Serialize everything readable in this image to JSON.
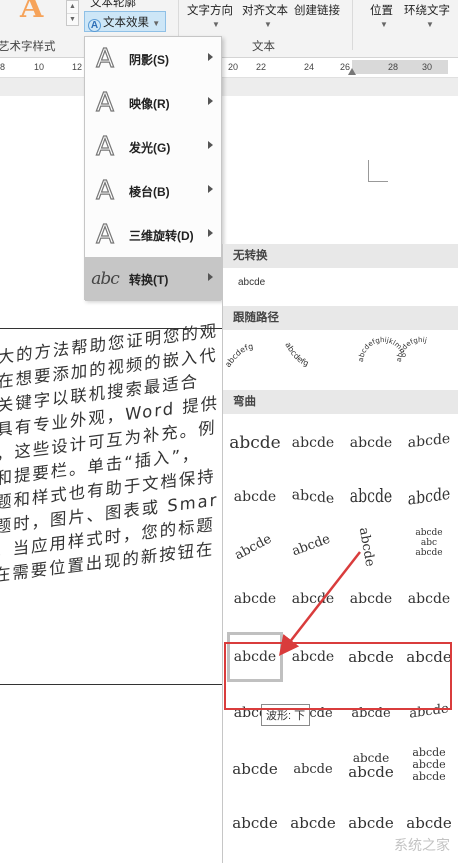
{
  "ribbon": {
    "text_outline_label": "文本轮廓",
    "text_effect_label": "文本效果",
    "wordart_group": "艺术字样式",
    "text_direction": "文字方向",
    "align_text": "对齐文本",
    "create_link": "创建链接",
    "text_group": "文本",
    "position": "位置",
    "wrap_text": "环绕文字"
  },
  "ruler": {
    "ticks": [
      "8",
      "10",
      "12",
      "20",
      "22",
      "24",
      "26",
      "28",
      "30"
    ]
  },
  "effects_menu": {
    "items": [
      {
        "label": "阴影(S)",
        "icon": "shadow-icon"
      },
      {
        "label": "映像(R)",
        "icon": "reflection-icon"
      },
      {
        "label": "发光(G)",
        "icon": "glow-icon"
      },
      {
        "label": "棱台(B)",
        "icon": "bevel-icon"
      },
      {
        "label": "三维旋转(D)",
        "icon": "3d-rotation-icon"
      },
      {
        "label": "转换(T)",
        "icon": "transform-icon"
      }
    ],
    "transform_glyph": "abc"
  },
  "gallery": {
    "no_transform_header": "无转换",
    "no_transform_sample": "abcde",
    "follow_path_header": "跟随路径",
    "warp_header": "弯曲",
    "sample_text": "abcde",
    "path_samples": [
      "abcdefg",
      "abcdefg",
      "abcdefghijklmno",
      "abcdefghij"
    ],
    "stacked": [
      "abcde",
      "abc",
      "abcde"
    ]
  },
  "tooltip": "波形: 下",
  "document_lines": [
    "大的方法帮助您证明您的观",
    "在想要添加的视频的嵌入代",
    "关键字以联机搜索最适合",
    "具有专业外观，Word 提供",
    "，这些设计可互为补充。例",
    "和提要栏。单击“插入”，",
    "题和样式也有助于文档保持",
    "题时，图片、图表或 Smar",
    "。当应用样式时，您的标题",
    "在需要位置出现的新按钮在"
  ],
  "colors": {
    "accent": "#d93c3c",
    "highlight": "#cde6f7",
    "menu_active": "#c6c6c6"
  },
  "watermark": "系统之家"
}
